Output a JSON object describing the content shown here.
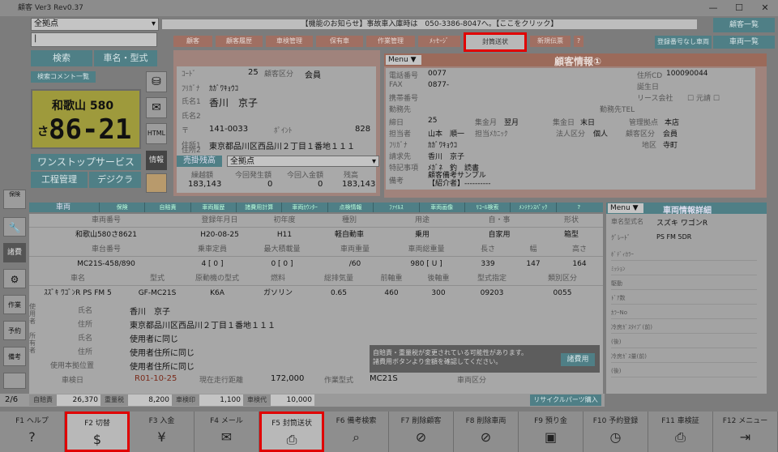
{
  "title": "顧客 Ver3 Rev0.37",
  "store": "全拠点",
  "notice": "【機能のお知らせ】事故車入庫時は　050-3386-8047へ。【ここをクリック】",
  "btn_customer_list": "顧客一覧",
  "btn_no_reg": "登録番号なし車両",
  "btn_vehicle_list": "車両一覧",
  "search": "検索",
  "model_search": "車名・型式",
  "detect_comment": "検索コメント一覧",
  "plate_area": "和歌山 580",
  "plate_kana": "さ",
  "plate_num": "86-21",
  "one_stop": "ワンストップサービス",
  "process_mgmt": "工程管理",
  "digikura": "デジクラ",
  "tabs": [
    "顧客",
    "顧客履歴",
    "車検管理",
    "保有車",
    "作業管理",
    "ﾒｯｾｰｼﾞ",
    "封筒送状",
    "新規伝票",
    "?"
  ],
  "customer": {
    "code_lbl": "ｺｰﾄﾞ",
    "code": "25",
    "cls_lbl": "顧客区分",
    "cls": "会員",
    "kana_lbl": "ﾌﾘｶﾞﾅ",
    "kana": "ｶｶﾞﾜｷｮｳｺ",
    "name_lbl": "氏名1",
    "name": "香川　京子",
    "name2_lbl": "氏名2",
    "zip_lbl": "〒",
    "zip": "141-0033",
    "point_lbl": "ﾎﾟｲﾝﾄ",
    "point": "828",
    "addr_lbl": "住所1",
    "addr": "東京都品川区西品川２丁目１番地１１１",
    "addr2_lbl": "住所2"
  },
  "balance": {
    "title": "売掛残高",
    "store": "全拠点",
    "cols": [
      "繰越額",
      "今回発生額",
      "今回入金額",
      "残高"
    ],
    "vals": [
      "183,143",
      "0",
      "0",
      "183,143"
    ]
  },
  "info_title": "顧客情報①",
  "menu": "Menu",
  "info": {
    "tel_lbl": "電話番号",
    "tel": "0077",
    "fax_lbl": "FAX",
    "fax": "0877-",
    "mobile_lbl": "携帯番号",
    "work_lbl": "勤務先",
    "birth_lbl": "締日",
    "birth": "25",
    "pay_lbl": "集金月",
    "pay": "翌月",
    "day_lbl": "集金日",
    "day": "末日",
    "mgr_lbl": "管理拠点",
    "mgr": "本店",
    "staff_lbl": "担当者",
    "staff": "山本　順一",
    "staff2_lbl": "担当ﾒｶﾆｯｸ",
    "corp_lbl": "法人区分",
    "corp": "個人",
    "cls_lbl": "顧客区分",
    "cls": "会員",
    "kana2_lbl": "ﾌﾘｶﾞﾅ",
    "kana2": "ｶｶﾞﾜｷｮｳｺ",
    "area_lbl": "地区",
    "area": "寺町",
    "bill_lbl": "請求先",
    "bill": "香川　京子",
    "memo_lbl": "特記事項",
    "memo": "ﾒｶﾞﾈ　釣　読書",
    "remark_lbl": "備考",
    "remark": "顧客備考サンプル\n【紹介者】----------",
    "id_lbl": "住所CD",
    "id": "100090044",
    "born_lbl": "誕生日",
    "lease_lbl": "リース会社",
    "lease_chk": "元請",
    "work2_lbl": "勤務先TEL"
  },
  "veh_tabs": [
    "車両",
    "保険",
    "自賠責",
    "車両履歴",
    "諸費用計算",
    "車両ｶｳﾝﾀｰ",
    "点検情報",
    "ﾌｧｲﾙｽ",
    "車両画像",
    "ﾘｺｰﾙ検索",
    "ﾒﾝﾃﾅﾝｽﾊﾟｯｸ",
    "?"
  ],
  "veh_hdr1": [
    "車両番号",
    "登録年月日",
    "初年度",
    "種別",
    "用途",
    "自・事",
    "形状"
  ],
  "veh_row1": [
    "和歌山580さ8621",
    "H20-08-25",
    "H11",
    "軽自動車",
    "乗用",
    "自家用",
    "箱型"
  ],
  "veh_hdr2": [
    "車台番号",
    "乗車定員",
    "最大積載量",
    "車両重量",
    "車両総重量",
    "長さ",
    "幅",
    "高さ"
  ],
  "veh_row2": [
    "MC21S-458/890",
    "4 [ 0 ]",
    "0 [ 0 ]",
    "/60",
    "980 [ U ]",
    "339",
    "147",
    "164"
  ],
  "veh_hdr3": [
    "車名",
    "型式",
    "原動機の型式",
    "燃料",
    "総排気量",
    "前軸重",
    "後軸重",
    "型式指定",
    "類別区分"
  ],
  "veh_row3": [
    "ｽｽﾞｷ ﾜｺﾞﾝR PS FM 5",
    "GF-MC21S",
    "K6A",
    "ガソリン",
    "0.65",
    "460",
    "300",
    "09203",
    "0055"
  ],
  "user_name_lbl": "氏名",
  "user_name": "香川　京子",
  "user_addr_lbl": "住所",
  "user_addr": "東京都品川区西品川２丁目１番地１１１",
  "own_name": "使用者に同じ",
  "own_addr": "使用者住所に同じ",
  "base_lbl": "使用本拠位置",
  "base": "使用者住所に同じ",
  "shaken_lbl": "車検日",
  "shaken": "R01-10-25",
  "km_lbl": "現在走行距離",
  "km": "172,000",
  "work_lbl": "作業型式",
  "work": "MC21S",
  "cls_lbl": "車両区分",
  "warn": "自賠責・重量税が変更されている可能性があります。\n諸費用ボタンより金額を確認してください。",
  "warn_btn": "諸費用",
  "recycle": "リサイクルパーツ購入",
  "fees": [
    [
      "自賠責",
      "26,370"
    ],
    [
      "重量税",
      "8,200"
    ],
    [
      "車検印",
      "1,100"
    ],
    [
      "車検代",
      "10,000"
    ]
  ],
  "page": "2/6",
  "detail_title": "車両情報詳細",
  "detail": {
    "model_lbl": "車名型式名",
    "model": "スズキ ワゴンR",
    "grade_lbl": "ｸﾞﾚｰﾄﾞ",
    "grade": "PS FM 5DR",
    "rows": [
      "ﾎﾞﾃﾞｨｶﾗｰ",
      "ﾐｯｼｮﾝ",
      "駆動",
      "ﾄﾞｱ数",
      "ｶﾗｰNo",
      "冷房ｶﾞｽﾀｲﾌﾟ(前)",
      "(後)",
      "冷房ｶﾞｽ量(前)",
      "(後)"
    ]
  },
  "side_icons": [
    "保険",
    "レンチ",
    "諸費",
    "設定",
    "作業",
    "予約",
    "備考"
  ],
  "fkeys": [
    [
      "F1 ヘルプ",
      "?"
    ],
    [
      "F2 切替",
      "$"
    ],
    [
      "F3 入金",
      "¥"
    ],
    [
      "F4 メール",
      "✉"
    ],
    [
      "F5 封筒送状",
      "⎙"
    ],
    [
      "F6 備考検索",
      "⌕"
    ],
    [
      "F7 削除顧客",
      "⊘"
    ],
    [
      "F8 削除車両",
      "⊘"
    ],
    [
      "F9 預り金",
      "▣"
    ],
    [
      "F10 予約登録",
      "◷"
    ],
    [
      "F11 車検証",
      "⎙"
    ],
    [
      "F12 メニュー",
      "⇥"
    ]
  ]
}
